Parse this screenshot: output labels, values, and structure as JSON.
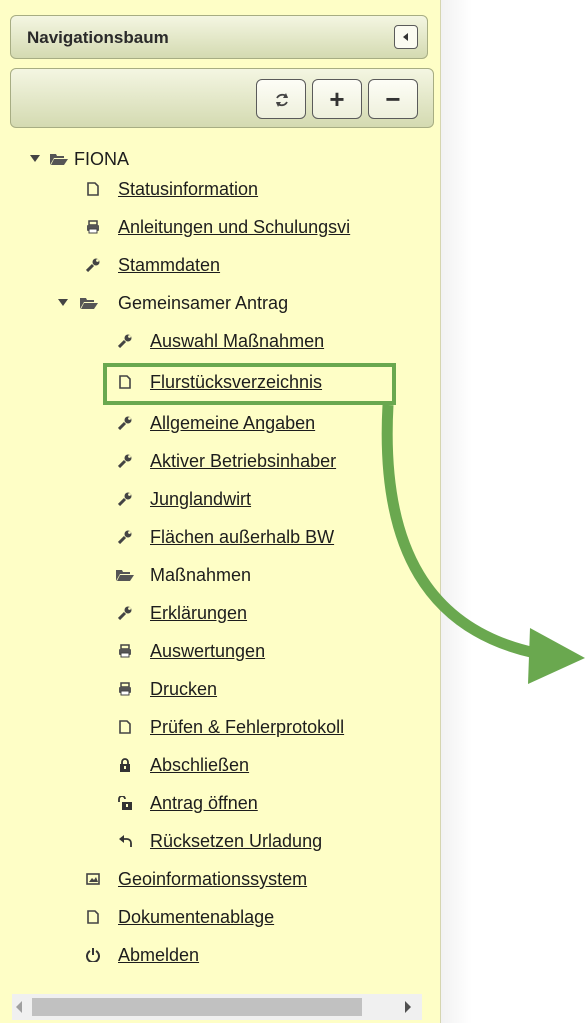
{
  "panel": {
    "title": "Navigationsbaum",
    "toolbar": {
      "refresh": "refresh-icon",
      "expand": "+",
      "collapse": "−"
    }
  },
  "tree": {
    "root": "FIONA",
    "items": [
      {
        "label": "Statusinformation",
        "icon": "document-icon"
      },
      {
        "label": "Anleitungen und Schulungsvi",
        "icon": "printer-icon"
      },
      {
        "label": "Stammdaten",
        "icon": "wrench-icon"
      },
      {
        "label": "Gemeinsamer Antrag",
        "icon": "folder-open-icon"
      },
      {
        "label": "Auswahl Maßnahmen",
        "icon": "wrench-icon"
      },
      {
        "label": "Flurstücksverzeichnis",
        "icon": "document-icon"
      },
      {
        "label": "Allgemeine Angaben",
        "icon": "wrench-icon"
      },
      {
        "label": "Aktiver Betriebsinhaber",
        "icon": "wrench-icon"
      },
      {
        "label": "Junglandwirt",
        "icon": "wrench-icon"
      },
      {
        "label": "Flächen außerhalb BW",
        "icon": "wrench-icon"
      },
      {
        "label": "Maßnahmen",
        "icon": "folder-open-icon"
      },
      {
        "label": "Erklärungen",
        "icon": "wrench-icon"
      },
      {
        "label": "Auswertungen",
        "icon": "printer-icon"
      },
      {
        "label": "Drucken",
        "icon": "printer-icon"
      },
      {
        "label": "Prüfen & Fehlerprotokoll",
        "icon": "document-icon"
      },
      {
        "label": "Abschließen",
        "icon": "lock-icon"
      },
      {
        "label": "Antrag öffnen",
        "icon": "unlock-icon"
      },
      {
        "label": "Rücksetzen Urladung",
        "icon": "undo-icon"
      },
      {
        "label": "Geoinformationssystem",
        "icon": "image-icon"
      },
      {
        "label": "Dokumentenablage",
        "icon": "document-icon"
      },
      {
        "label": "Abmelden",
        "icon": "power-icon"
      }
    ]
  },
  "colors": {
    "panel_bg": "#fefec6",
    "highlight": "#6aa84f",
    "arrow": "#6aa84f"
  }
}
